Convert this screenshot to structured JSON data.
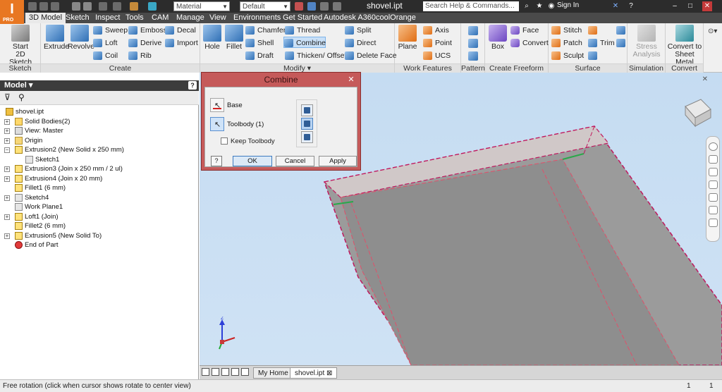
{
  "app": {
    "logo_text": "I",
    "logo_sub": "PRO",
    "material_combo": "Material",
    "appearance_combo": "Default",
    "document_title": "shovel.ipt",
    "search_placeholder": "Search Help & Commands...",
    "signin_label": "Sign In"
  },
  "ribbon_tabs": [
    {
      "label": "3D Model",
      "active": true
    },
    {
      "label": "Sketch"
    },
    {
      "label": "Inspect"
    },
    {
      "label": "Tools"
    },
    {
      "label": "CAM"
    },
    {
      "label": "Manage"
    },
    {
      "label": "View"
    },
    {
      "label": "Environments"
    },
    {
      "label": "Get Started"
    },
    {
      "label": "Autodesk A360"
    },
    {
      "label": "coolOrange"
    }
  ],
  "ribbon": {
    "sketch": {
      "label": "Sketch",
      "start_line1": "Start",
      "start_line2": "2D Sketch"
    },
    "create": {
      "label": "Create",
      "extrude": "Extrude",
      "revolve": "Revolve",
      "sweep": "Sweep",
      "loft": "Loft",
      "coil": "Coil",
      "emboss": "Emboss",
      "derive": "Derive",
      "rib": "Rib",
      "decal": "Decal",
      "import": "Import"
    },
    "modify": {
      "label": "Modify ▾",
      "hole": "Hole",
      "fillet": "Fillet",
      "chamfer": "Chamfer",
      "shell": "Shell",
      "draft": "Draft",
      "thread": "Thread",
      "combine": "Combine",
      "thicken": "Thicken/ Offset",
      "split": "Split",
      "direct": "Direct",
      "delete_face": "Delete Face"
    },
    "work_features": {
      "label": "Work Features",
      "plane": "Plane",
      "axis": "Axis",
      "point": "Point",
      "ucs": "UCS"
    },
    "pattern": {
      "label": "Pattern"
    },
    "freeform": {
      "label": "Create Freeform",
      "box": "Box",
      "face": "Face",
      "convert": "Convert"
    },
    "surface": {
      "label": "Surface",
      "stitch": "Stitch",
      "patch": "Patch",
      "sculpt": "Sculpt",
      "trim": "Trim"
    },
    "simulation": {
      "label": "Simulation",
      "stress_line1": "Stress",
      "stress_line2": "Analysis"
    },
    "convert": {
      "label": "Convert",
      "sheet_line1": "Convert to",
      "sheet_line2": "Sheet Metal"
    }
  },
  "browser": {
    "title": "Model ▾",
    "help": "?",
    "tree": [
      {
        "label": "shovel.ipt",
        "level": 0,
        "icon": "part-icon",
        "expander": ""
      },
      {
        "label": "Solid Bodies(2)",
        "level": 1,
        "icon": "solid-bodies-icon",
        "expander": "+"
      },
      {
        "label": "View: Master",
        "level": 1,
        "icon": "view-icon",
        "expander": "+"
      },
      {
        "label": "Origin",
        "level": 1,
        "icon": "folder-icon",
        "expander": "+"
      },
      {
        "label": "Extrusion2 (New Solid x 250 mm)",
        "level": 1,
        "icon": "extrusion-icon",
        "expander": "−"
      },
      {
        "label": "Sketch1",
        "level": 2,
        "icon": "sketch-icon",
        "expander": ""
      },
      {
        "label": "Extrusion3 (Join x 250 mm / 2 ul)",
        "level": 1,
        "icon": "extrusion-icon",
        "expander": "+"
      },
      {
        "label": "Extrusion4 (Join x 20 mm)",
        "level": 1,
        "icon": "extrusion-icon",
        "expander": "+"
      },
      {
        "label": "Fillet1 (6 mm)",
        "level": 1,
        "icon": "fillet-icon",
        "expander": ""
      },
      {
        "label": "Sketch4",
        "level": 1,
        "icon": "sketch-icon",
        "expander": "+"
      },
      {
        "label": "Work Plane1",
        "level": 1,
        "icon": "workplane-icon",
        "expander": ""
      },
      {
        "label": "Loft1 (Join)",
        "level": 1,
        "icon": "loft-icon",
        "expander": "+"
      },
      {
        "label": "Fillet2 (6 mm)",
        "level": 1,
        "icon": "fillet-icon",
        "expander": ""
      },
      {
        "label": "Extrusion5 (New Solid To)",
        "level": 1,
        "icon": "extrusion-icon",
        "expander": "+"
      },
      {
        "label": "End of Part",
        "level": 1,
        "icon": "end-of-part-icon",
        "expander": ""
      }
    ]
  },
  "combine_dialog": {
    "title": "Combine",
    "base_label": "Base",
    "toolbody_label": "Toolbody (1)",
    "keep_toolbody_label": "Keep Toolbody",
    "keep_toolbody_checked": false,
    "help": "?",
    "ok": "OK",
    "cancel": "Cancel",
    "apply": "Apply"
  },
  "doc_tabs": [
    {
      "label": "My Home"
    },
    {
      "label": "shovel.ipt ⊠",
      "active": true
    }
  ],
  "status": {
    "text": "Free rotation (click when cursor shows rotate to center view)",
    "count1": "1",
    "count2": "1"
  },
  "triad": {
    "z": "Z"
  }
}
